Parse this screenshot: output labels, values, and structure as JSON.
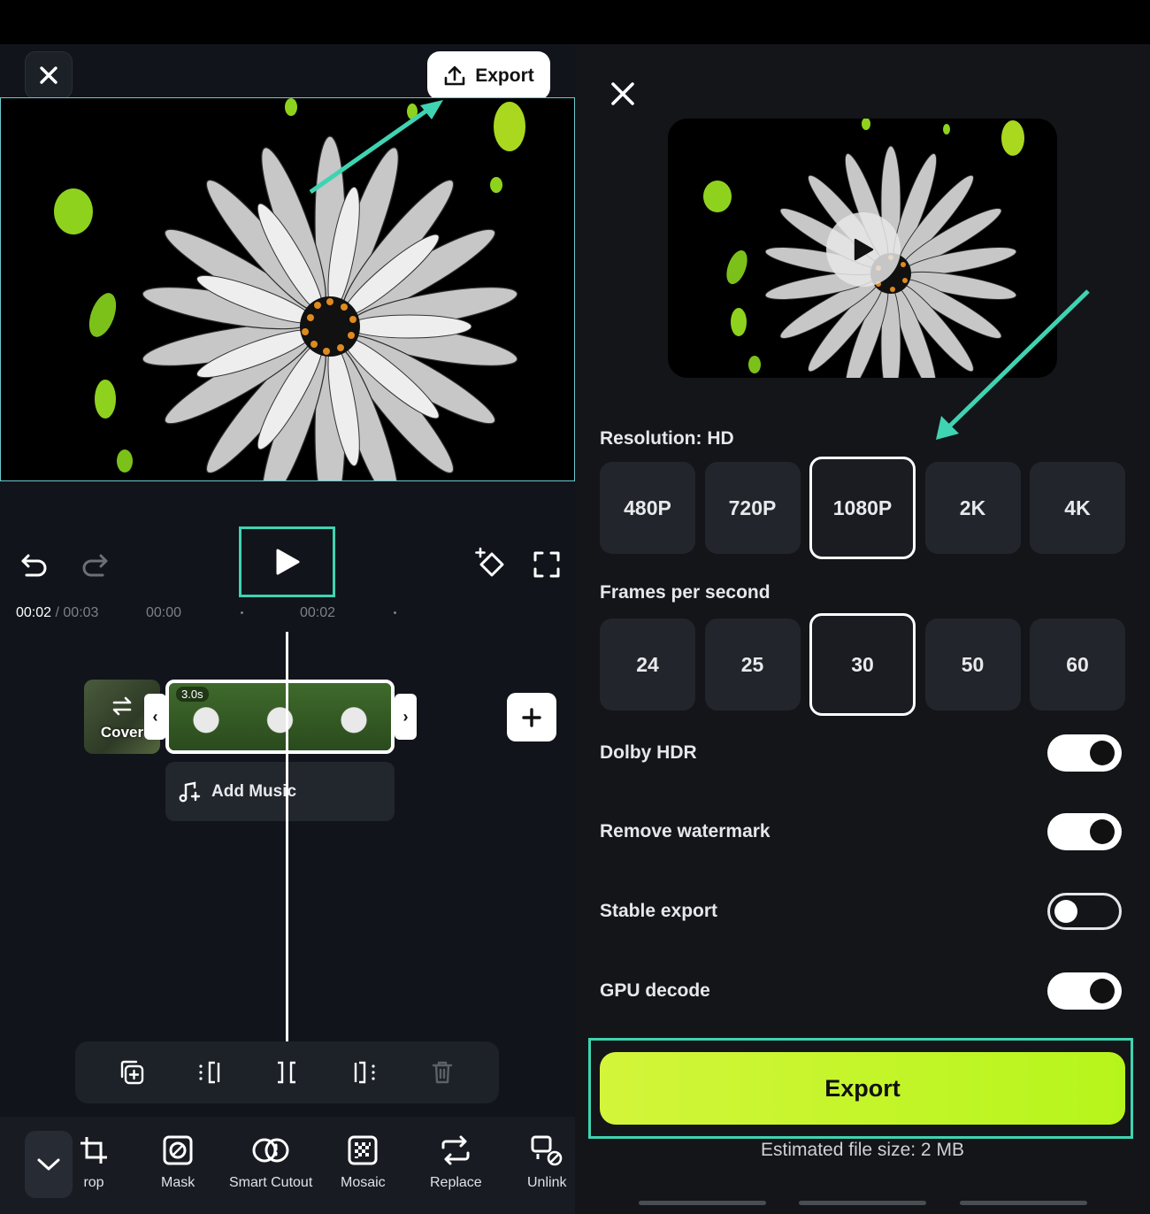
{
  "editor": {
    "export_label": "Export",
    "timeline": {
      "current_time": "00:02",
      "separator": " / ",
      "total_time": "00:03",
      "ticks": [
        "00:00",
        "00:02"
      ],
      "clip_duration": "3.0s",
      "cover_label": "Cover",
      "add_music_label": "Add Music"
    },
    "tools": [
      {
        "label": "rop",
        "icon": "crop-icon"
      },
      {
        "label": "Mask",
        "icon": "mask-icon"
      },
      {
        "label": "Smart Cutout",
        "icon": "smart-cutout-icon"
      },
      {
        "label": "Mosaic",
        "icon": "mosaic-icon"
      },
      {
        "label": "Replace",
        "icon": "replace-icon"
      },
      {
        "label": "Unlink",
        "icon": "unlink-icon"
      }
    ]
  },
  "export_panel": {
    "resolution_label": "Resolution: HD",
    "resolutions": [
      "480P",
      "720P",
      "1080P",
      "2K",
      "4K"
    ],
    "selected_resolution": "1080P",
    "fps_label": "Frames per second",
    "fps_options": [
      "24",
      "25",
      "30",
      "50",
      "60"
    ],
    "selected_fps": "30",
    "toggles": [
      {
        "label": "Dolby HDR",
        "on": true
      },
      {
        "label": "Remove watermark",
        "on": true
      },
      {
        "label": "Stable export",
        "on": false
      },
      {
        "label": "GPU decode",
        "on": true
      }
    ],
    "export_button": "Export",
    "estimated_size": "Estimated file size: 2 MB"
  },
  "colors": {
    "accent_teal": "#3fd3b2",
    "export_green": "#c4f52a",
    "petal_green": "#8fd21e"
  }
}
